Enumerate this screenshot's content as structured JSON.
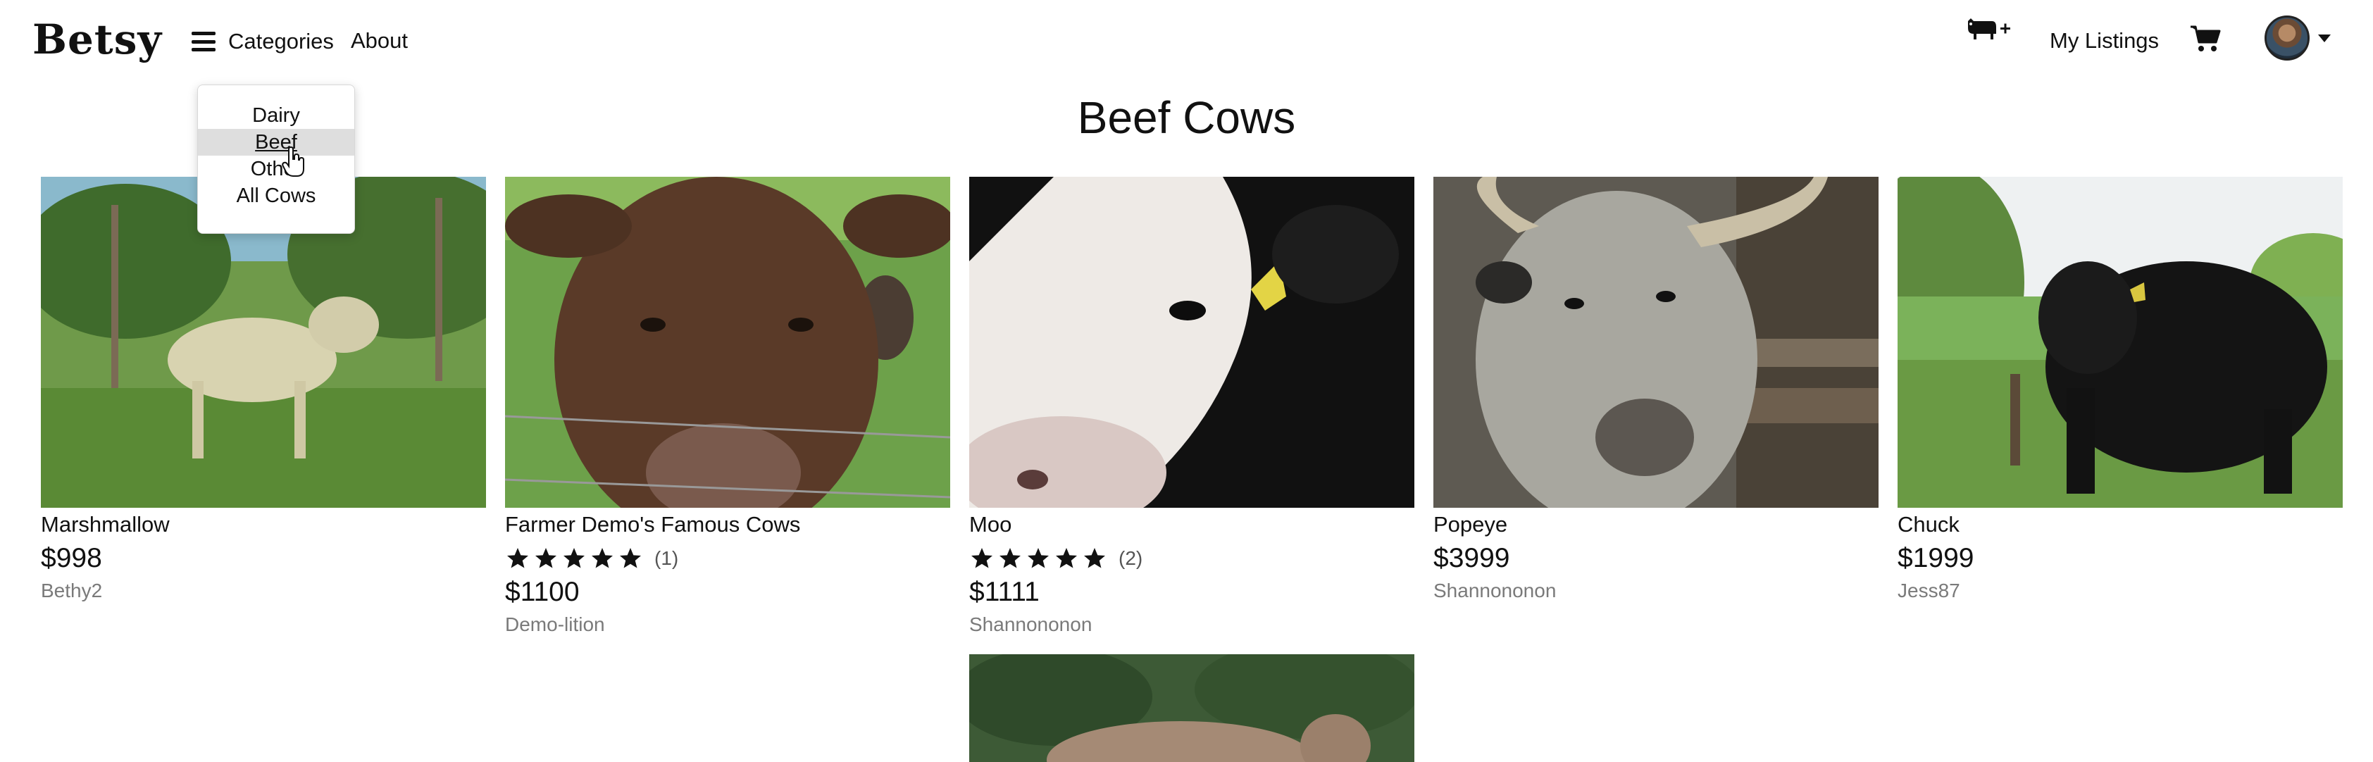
{
  "header": {
    "logo": "Betsy",
    "menu_label": "Categories",
    "about_label": "About",
    "my_listings_label": "My Listings",
    "icons": [
      "add-cow-icon",
      "cart-icon",
      "avatar",
      "chevron-down-icon",
      "hamburger-icon"
    ]
  },
  "dropdown": {
    "items": [
      {
        "label": "Dairy",
        "active": false
      },
      {
        "label": "Beef",
        "active": true
      },
      {
        "label": "Other",
        "active": false
      },
      {
        "label": "All Cows",
        "active": false
      }
    ]
  },
  "page": {
    "title": "Beef Cows"
  },
  "listings": [
    {
      "name": "Marshmallow",
      "price": "$998",
      "seller": "Bethy2",
      "rating": null,
      "review_count": null
    },
    {
      "name": "Farmer Demo's Famous Cows",
      "price": "$1100",
      "seller": "Demo-lition",
      "rating": 5,
      "review_count": "(1)"
    },
    {
      "name": "Moo",
      "price": "$1111",
      "seller": "Shannononon",
      "rating": 5,
      "review_count": "(2)"
    },
    {
      "name": "Popeye",
      "price": "$3999",
      "seller": "Shannononon",
      "rating": null,
      "review_count": null
    },
    {
      "name": "Chuck",
      "price": "$1999",
      "seller": "Jess87",
      "rating": null,
      "review_count": null
    },
    {
      "name": "",
      "price": "",
      "seller": "",
      "rating": null,
      "review_count": null
    }
  ],
  "colors": {
    "text": "#111111",
    "muted": "#7a7a7a",
    "active_item_bg": "#dedede"
  }
}
